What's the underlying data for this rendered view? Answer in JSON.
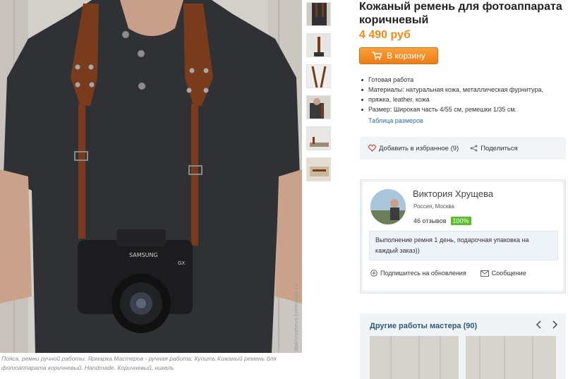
{
  "product": {
    "title_line1": "Кожаный ремень для фотоаппарата",
    "title_line2": "коричневый",
    "price": "4 490 руб",
    "cart_button": "В корзину",
    "features": [
      "Готовая работа",
      "Материалы: натуральная кожа, металлическая фурнитура,",
      "пряжка, leather, кожа",
      "Размер: Широкая часть 4/55 см, ремешки 1/35 см."
    ],
    "size_table_link": "Таблица размеров",
    "favorite_label": "Добавить в избранное (9)",
    "share_label": "Поделиться"
  },
  "photo": {
    "caption_line1": "Пояса, ремни ручной работы. Ярмарка Мастеров - ручная работа. Купить Кожаный ремень для",
    "caption_line2": "фотоаппарата коричневый. Handmade. Коричневый, никель",
    "camera_brand": "SAMSUNG",
    "camera_model": "GX",
    "watermark": "Wakhrusheva.livemaster.ru"
  },
  "seller": {
    "name": "Виктория Хрущева",
    "location": "Россия, Москва",
    "reviews": "46 отзывов",
    "rating_badge": "100%",
    "note_line1": "Выполнение ремня 1 день, подарочная упаковка на",
    "note_line2": "каждый заказ))",
    "subscribe_label": "Подпишитесь на обновления",
    "message_label": "Сообщение"
  },
  "other_works": {
    "title": "Другие работы мастера (90)"
  },
  "colors": {
    "accent_orange": "#f08a18",
    "link_blue": "#2b6d9e",
    "badge_green": "#5bbf2b",
    "strap_brown": "#7a3b1c"
  },
  "icons": [
    "cart-icon",
    "heart-icon",
    "share-icon",
    "plus-circle-icon",
    "envelope-icon",
    "chevron-left-icon",
    "chevron-right-icon"
  ]
}
